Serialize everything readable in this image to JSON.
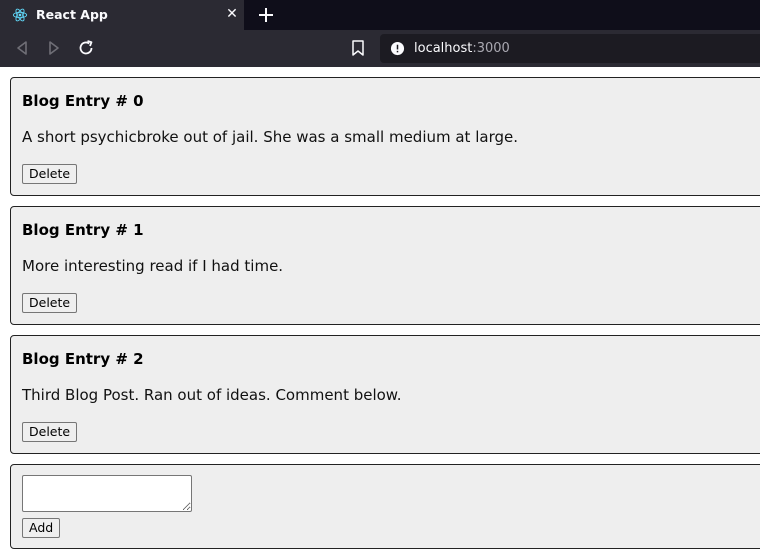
{
  "browser": {
    "tab_title": "React App",
    "tab_icon": "react-icon",
    "url_host": "localhost",
    "url_port": ":3000",
    "colors": {
      "tabbar": "#0f0e1a",
      "toolbar": "#2b2a33",
      "urlbar": "#1c1b22"
    }
  },
  "entries": [
    {
      "title": "Blog Entry # 0",
      "body": "A short psychicbroke out of jail. She was a small medium at large.",
      "delete_label": "Delete"
    },
    {
      "title": "Blog Entry # 1",
      "body": "More interesting read if I had time.",
      "delete_label": "Delete"
    },
    {
      "title": "Blog Entry # 2",
      "body": "Third Blog Post. Ran out of ideas. Comment below.",
      "delete_label": "Delete"
    }
  ],
  "composer": {
    "textarea_value": "",
    "add_label": "Add"
  },
  "colors": {
    "card_bg": "#eeeeee",
    "card_border": "#222222"
  }
}
